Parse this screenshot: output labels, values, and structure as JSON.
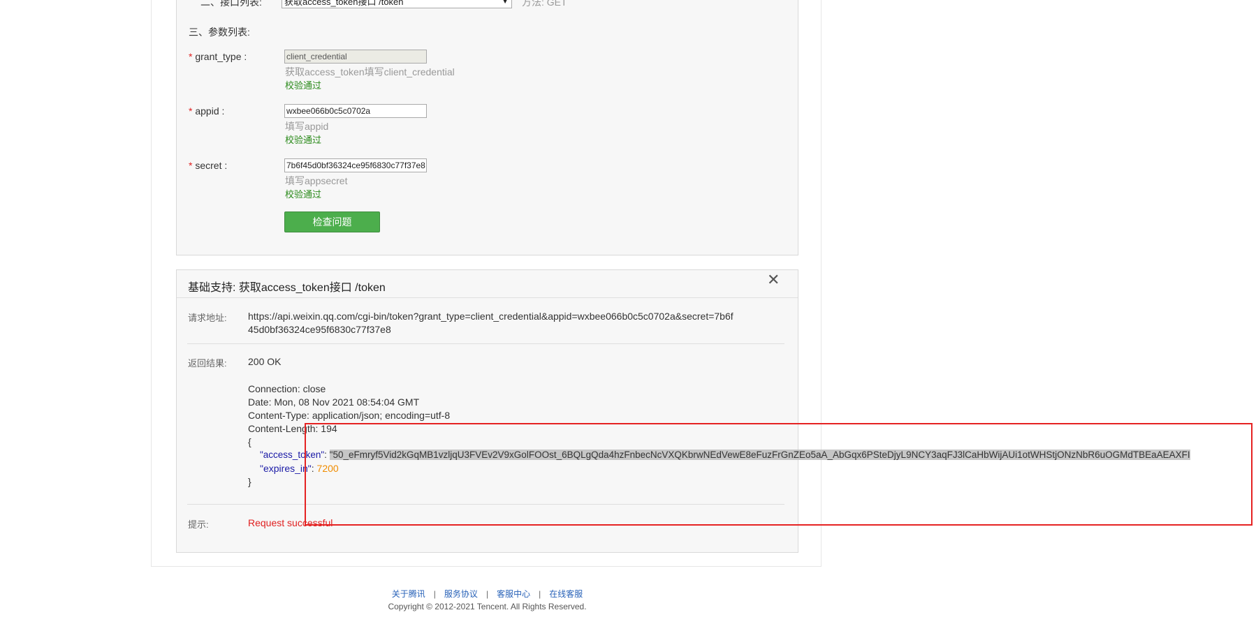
{
  "form": {
    "api_list_label": "二、接口列表:",
    "api_select_value": "获取access_token接口 /token",
    "method_label": "方法:",
    "method_value": "GET",
    "params_label": "三、参数列表:",
    "required_mark": "*",
    "params": [
      {
        "label": "grant_type :",
        "value": "client_credential",
        "hint": "获取access_token填写client_credential",
        "status": "校验通过"
      },
      {
        "label": "appid :",
        "value": "wxbee066b0c5c0702a",
        "hint": "填写appid",
        "status": "校验通过"
      },
      {
        "label": "secret :",
        "value": "7b6f45d0bf36324ce95f6830c77f37e8",
        "hint": "填写appsecret",
        "status": "校验通过"
      }
    ],
    "check_button": "检查问题"
  },
  "result": {
    "title": "基础支持: 获取access_token接口 /token",
    "request_label": "请求地址:",
    "request_url_line1": "https://api.weixin.qq.com/cgi-bin/token?grant_type=client_credential&appid=wxbee066b0c5c0702a&secret=7b6f",
    "request_url_line2": "45d0bf36324ce95f6830c77f37e8",
    "return_label": "返回结果:",
    "status": "200 OK",
    "headers": [
      "Connection: close",
      "Date: Mon, 08 Nov 2021 08:54:04 GMT",
      "Content-Type: application/json; encoding=utf-8",
      "Content-Length: 194"
    ],
    "brace_open": "{",
    "brace_close": "}",
    "json_key_token": "\"access_token\"",
    "json_token_value": "\"50_eFmryf5Vid2kGqMB1vzljqU3FVEv2V9xGolFOOst_6BQLgQda4hzFnbecNcVXQKbrwNEdVewE8eFuzFrGnZEo5aA_AbGqx6PSteDjyL9NCY3aqFJ3lCaHbWijAUi1otWHStjONzNbR6uOGMdTBEaAEAXFI",
    "json_key_expires": "\"expires_in\"",
    "json_expires_value": "7200",
    "tip_label": "提示:",
    "tip_value": "Request successful"
  },
  "footer": {
    "links": [
      "关于腾讯",
      "服务协议",
      "客服中心",
      "在线客服"
    ],
    "separator": "|",
    "copyright": "Copyright © 2012-2021 Tencent. All Rights Reserved."
  },
  "colors": {
    "success": "#2a8a1a",
    "error": "#e02020",
    "button": "#4cae4c",
    "highlight_box": "#e52222"
  },
  "icons": {
    "close": "close-icon",
    "dropdown": "chevron-down-icon"
  }
}
